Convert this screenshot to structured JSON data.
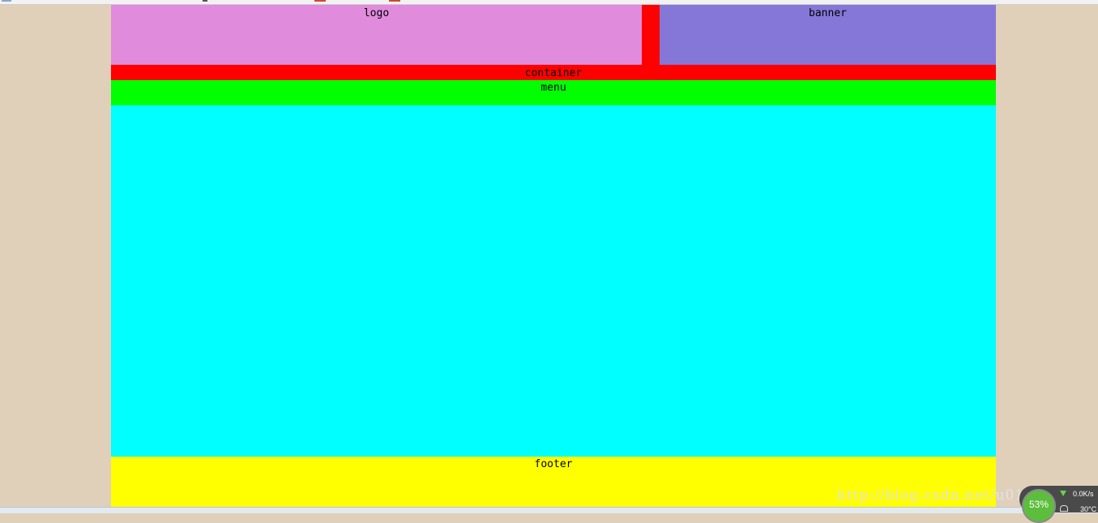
{
  "layout_labels": {
    "logo": "logo",
    "banner": "banner",
    "container": "container",
    "menu": "menu",
    "footer": "footer"
  },
  "colors": {
    "page_background": "#e0d0ba",
    "container": "#ff0000",
    "logo": "#e08bdc",
    "banner": "#8577d8",
    "menu": "#00ff00",
    "content": "#00ffff",
    "footer": "#ffff00"
  },
  "watermark": "http://blog.csdn.net/u01211",
  "system_monitor": {
    "cpu_percent": "53%",
    "net_speed": "0.0K/s",
    "temperature": "30°C"
  }
}
